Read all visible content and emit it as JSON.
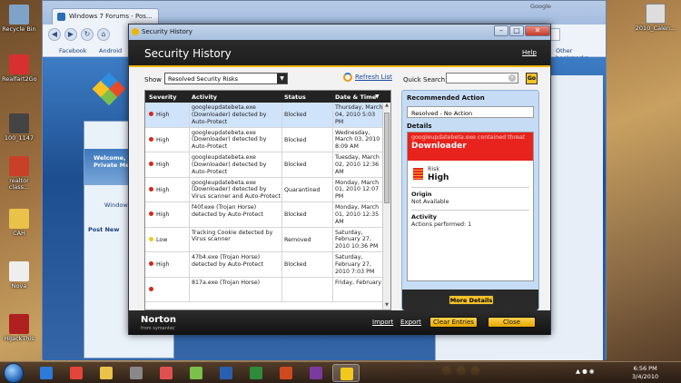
{
  "desktop": {
    "icons": [
      {
        "label": "Recycle Bin",
        "color": "#7fa3c8"
      },
      {
        "label": "Realfart2Go",
        "color": "#d83030"
      },
      {
        "label": "100_1147",
        "color": "#444"
      },
      {
        "label": "realtor class...",
        "color": "#c8402a"
      },
      {
        "label": "CAH",
        "color": "#e9c24a"
      },
      {
        "label": "Nova",
        "color": "#eee"
      },
      {
        "label": "HiJackThis",
        "color": "#b02020"
      }
    ],
    "right_icon": {
      "label": "2010_Calen...",
      "color": "#ddd"
    }
  },
  "browser": {
    "tab_title": "Windows 7 Forums - Pos...",
    "bookmarks": [
      "Facebook",
      "Android"
    ],
    "other_bookmarks": "Other bookmarks",
    "search_engine": "Google",
    "forum_banner": "Welcome, You last vis... Private Me...",
    "forum_link": "Windows",
    "post_label": "Post New"
  },
  "norton": {
    "window_title": "Security History",
    "header_title": "Security History",
    "help": "Help",
    "show_label": "Show",
    "show_value": "Resolved Security Risks",
    "refresh": "Refresh List",
    "quick_search_label": "Quick Search:",
    "go": "Go",
    "columns": [
      "Severity",
      "Activity",
      "Status",
      "Date & Time"
    ],
    "rows": [
      {
        "severity": "High",
        "color": "#d9261c",
        "activity": "googleupdatebeta.exe (Downloader) detected by Auto-Protect",
        "status": "Blocked",
        "date": "Thursday, March 04, 2010 5:03 PM",
        "selected": true
      },
      {
        "severity": "High",
        "color": "#d9261c",
        "activity": "googleupdatebeta.exe (Downloader) detected by Auto-Protect",
        "status": "Blocked",
        "date": "Wednesday, March 03, 2010 8:09 AM"
      },
      {
        "severity": "High",
        "color": "#d9261c",
        "activity": "googleupdatebeta.exe (Downloader) detected by Auto-Protect",
        "status": "Blocked",
        "date": "Tuesday, March 02, 2010 12:36 AM"
      },
      {
        "severity": "High",
        "color": "#d9261c",
        "activity": "googleupdatebeta.exe (Downloader) detected by Virus scanner and Auto-Protect",
        "status": "Quarantined",
        "date": "Monday, March 01, 2010 12:07 PM"
      },
      {
        "severity": "High",
        "color": "#d9261c",
        "activity": "f40f.exe (Trojan Horse) detected by Auto-Protect",
        "status": "Blocked",
        "date": "Monday, March 01, 2010 12:35 AM"
      },
      {
        "severity": "Low",
        "color": "#f2c81c",
        "activity": "Tracking Cookie detected by Virus scanner",
        "status": "Removed",
        "date": "Saturday, February 27, 2010 10:36 PM"
      },
      {
        "severity": "High",
        "color": "#d9261c",
        "activity": "47b4.exe (Trojan Horse) detected by Auto-Protect",
        "status": "Blocked",
        "date": "Saturday, February 27, 2010 7:03 PM"
      },
      {
        "severity": "",
        "color": "#d9261c",
        "activity": "817a.exe (Trojan Horse)",
        "status": "",
        "date": "Friday, February"
      }
    ],
    "details": {
      "recommended_action_label": "Recommended Action",
      "recommended_action": "Resolved - No Action",
      "details_label": "Details",
      "threat_line": "googleupdatebeta.exe contained threat",
      "threat_name": "Downloader",
      "risk_label": "Risk",
      "risk_value": "High",
      "origin_label": "Origin",
      "origin_value": "Not Available",
      "activity_label": "Activity",
      "activity_value": "Actions performed: 1",
      "more_details": "More Details"
    },
    "footer": {
      "logo": "Norton",
      "logo_sub": "from symantec",
      "import": "Import",
      "export": "Export",
      "clear_entries": "Clear Entries",
      "close": "Close"
    }
  },
  "taskbar": {
    "clock_time": "6:56 PM",
    "clock_date": "3/4/2010",
    "apps": [
      {
        "name": "ie",
        "color": "#2d7ad8"
      },
      {
        "name": "chrome",
        "color": "#e4453a"
      },
      {
        "name": "explorer",
        "color": "#e9c24a"
      },
      {
        "name": "media",
        "color": "#888"
      },
      {
        "name": "yahoo",
        "color": "#e05050"
      },
      {
        "name": "picasa",
        "color": "#7ac04a"
      },
      {
        "name": "word",
        "color": "#2a5fb0"
      },
      {
        "name": "excel",
        "color": "#2f8a3a"
      },
      {
        "name": "powerpoint",
        "color": "#d04a20"
      },
      {
        "name": "onenote",
        "color": "#7a3aa0"
      },
      {
        "name": "norton",
        "color": "#f2c81c"
      }
    ]
  }
}
